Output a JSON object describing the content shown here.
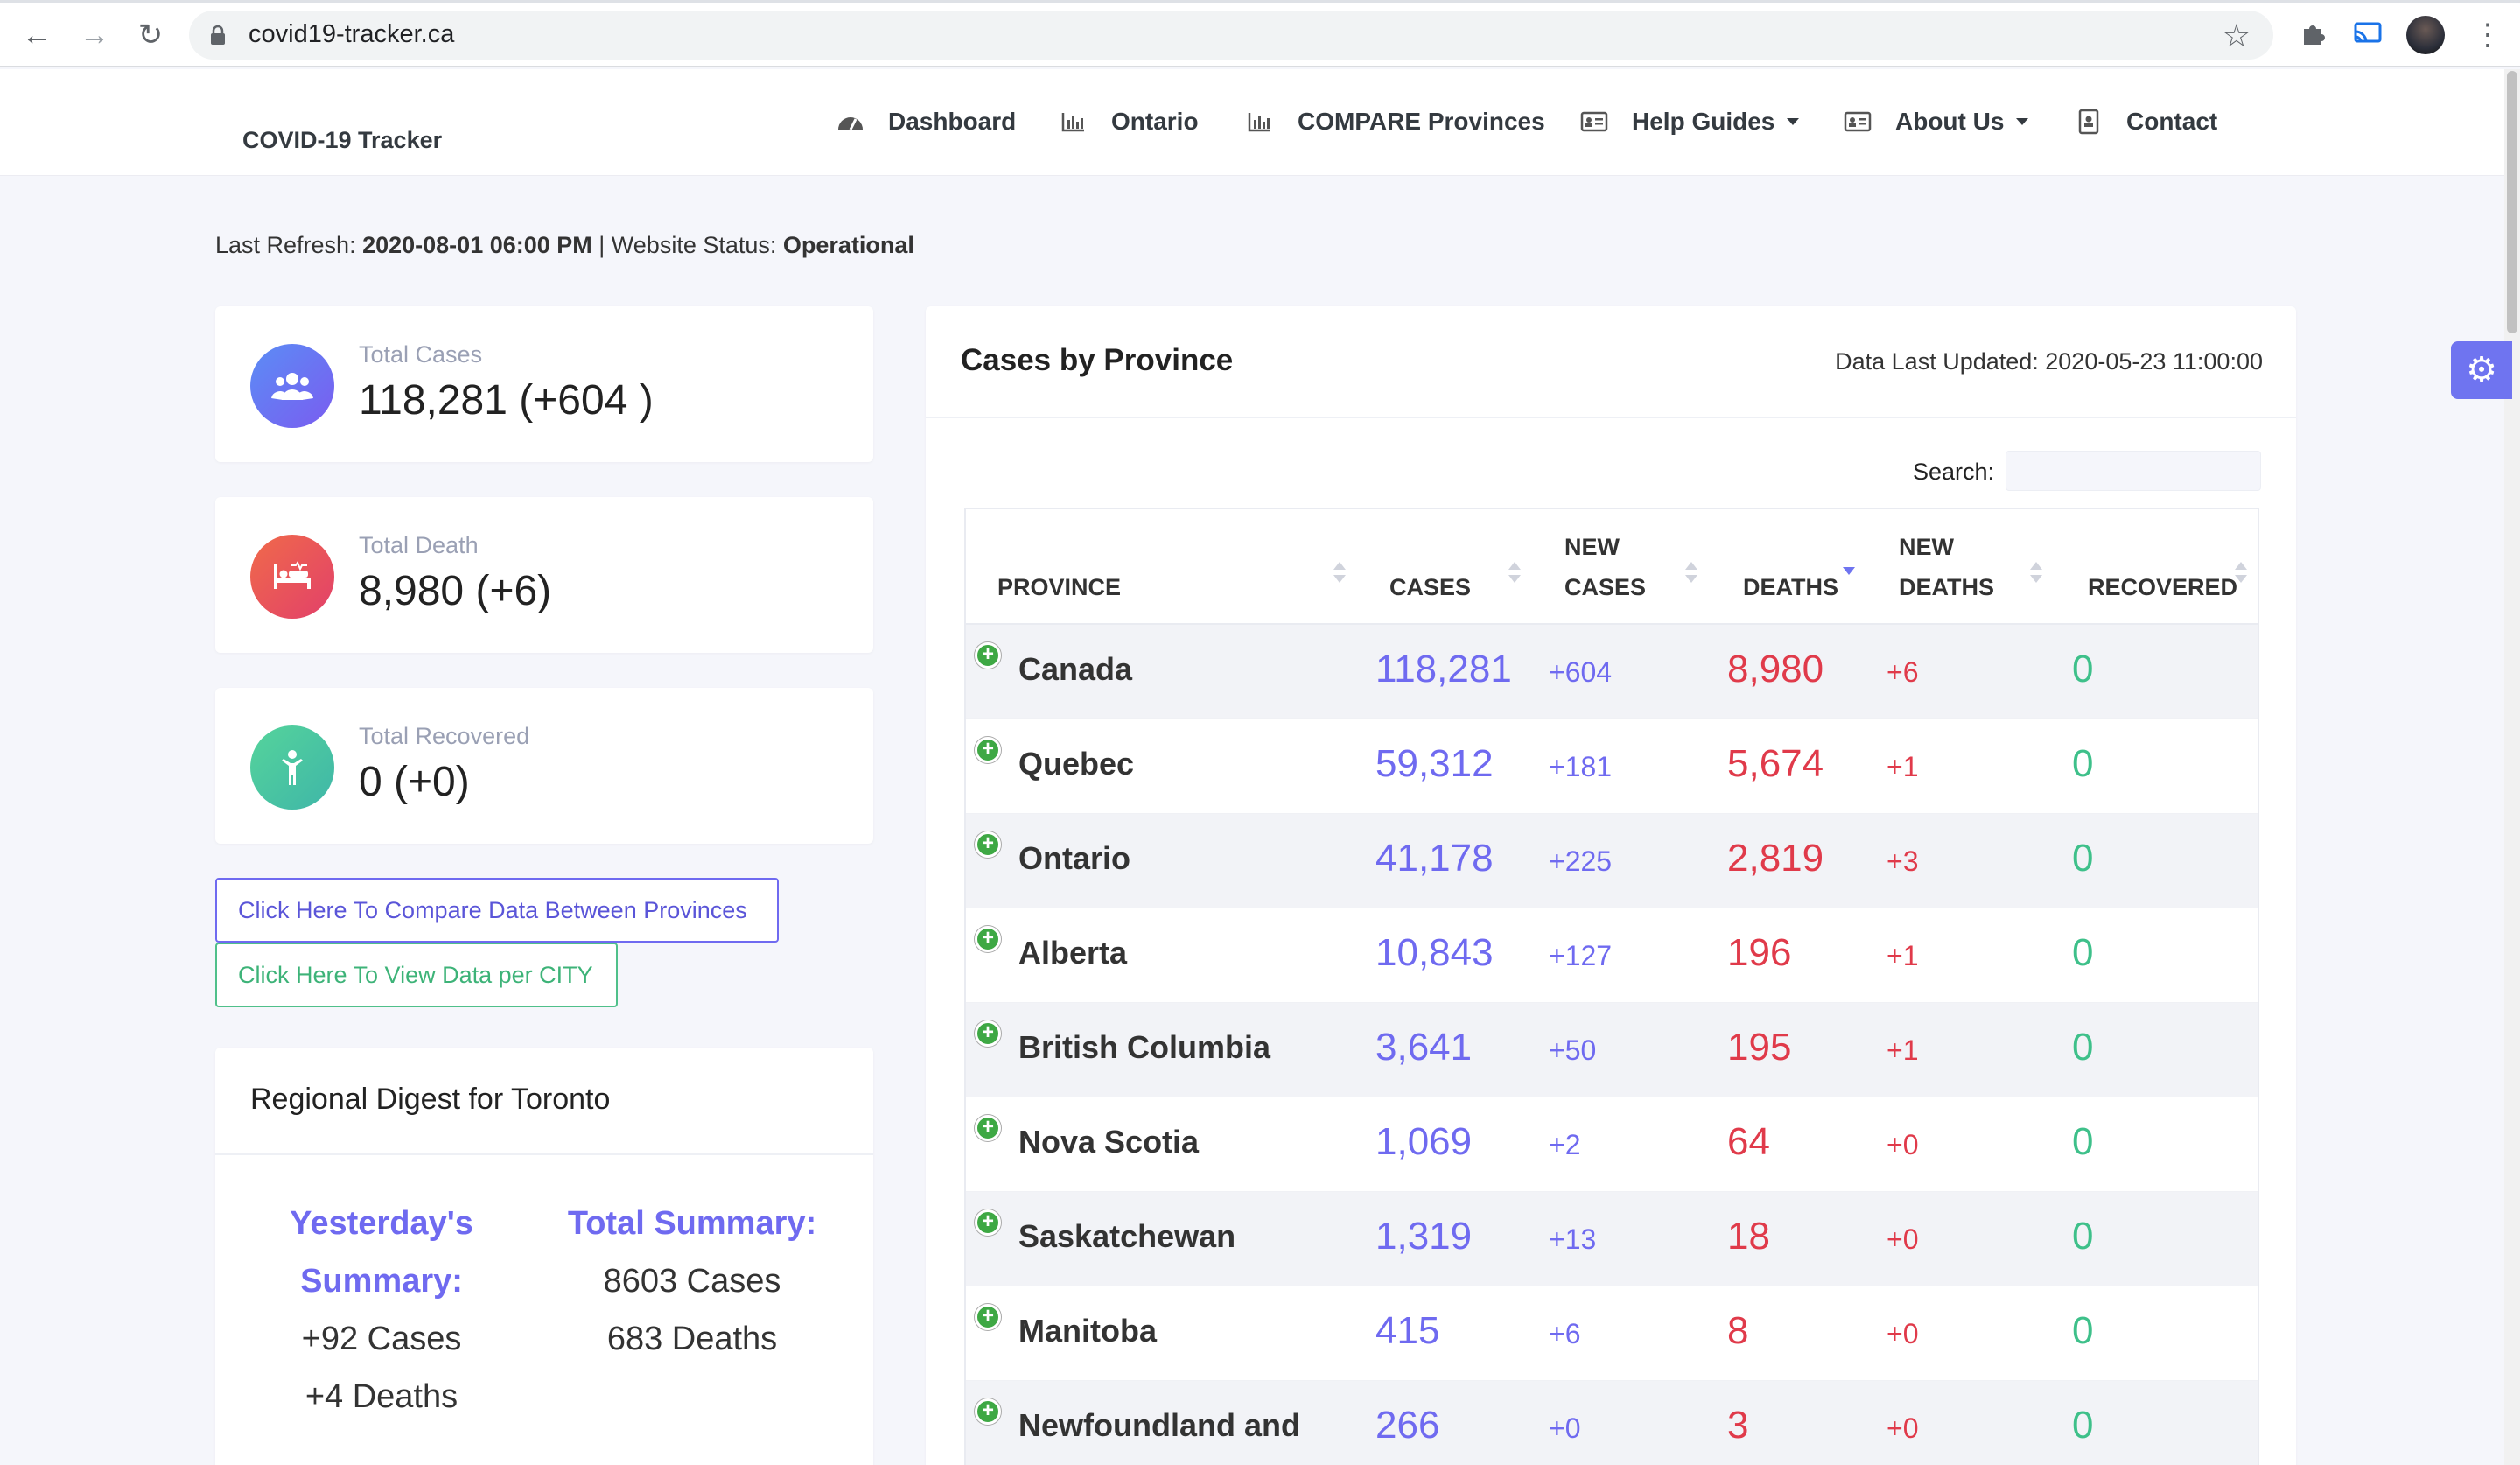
{
  "browser": {
    "url": "covid19-tracker.ca"
  },
  "navbar": {
    "brand": "COVID-19 Tracker",
    "items": [
      {
        "label": "Dashboard"
      },
      {
        "label": "Ontario"
      },
      {
        "label": "COMPARE Provinces"
      },
      {
        "label": "Help Guides"
      },
      {
        "label": "About Us"
      },
      {
        "label": "Contact"
      }
    ]
  },
  "status": {
    "refresh_label": "Last Refresh:",
    "refresh_value": "2020-08-01 06:00 PM",
    "separator": "| Website Status:",
    "status_value": "Operational"
  },
  "stats": {
    "cases": {
      "label": "Total Cases",
      "value": "118,281 (+604 )",
      "color": "#6f74f0"
    },
    "death": {
      "label": "Total Death",
      "value": "8,980 (+6)",
      "color": "#e8505b"
    },
    "recovered": {
      "label": "Total Recovered",
      "value": "0 (+0)",
      "color": "#4fcb9a"
    }
  },
  "buttons": {
    "compare": "Click Here To Compare Data Between Provinces",
    "city": "Click Here To View Data per CITY"
  },
  "digest": {
    "title": "Regional Digest for Toronto",
    "yesterday_header_1": "Yesterday's",
    "yesterday_header_2": "Summary:",
    "yesterday_cases": "+92 Cases",
    "yesterday_deaths": "+4 Deaths",
    "total_header": "Total Summary:",
    "total_cases": "8603 Cases",
    "total_deaths": "683 Deaths"
  },
  "province_table": {
    "title": "Cases by Province",
    "updated": "Data Last Updated: 2020-05-23 11:00:00",
    "search_label": "Search:",
    "search_value": "",
    "sorted_column": "deaths",
    "headers": {
      "province": "PROVINCE",
      "cases": "CASES",
      "new_cases_1": "NEW",
      "new_cases_2": "CASES",
      "deaths": "DEATHS",
      "new_deaths_1": "NEW",
      "new_deaths_2": "DEATHS",
      "recovered": "RECOVERED"
    },
    "rows": [
      {
        "province": "Canada",
        "cases": "118,281",
        "new_cases": "+604",
        "deaths": "8,980",
        "new_deaths": "+6",
        "recovered": "0"
      },
      {
        "province": "Quebec",
        "cases": "59,312",
        "new_cases": "+181",
        "deaths": "5,674",
        "new_deaths": "+1",
        "recovered": "0"
      },
      {
        "province": "Ontario",
        "cases": "41,178",
        "new_cases": "+225",
        "deaths": "2,819",
        "new_deaths": "+3",
        "recovered": "0"
      },
      {
        "province": "Alberta",
        "cases": "10,843",
        "new_cases": "+127",
        "deaths": "196",
        "new_deaths": "+1",
        "recovered": "0"
      },
      {
        "province": "British Columbia",
        "cases": "3,641",
        "new_cases": "+50",
        "deaths": "195",
        "new_deaths": "+1",
        "recovered": "0"
      },
      {
        "province": "Nova Scotia",
        "cases": "1,069",
        "new_cases": "+2",
        "deaths": "64",
        "new_deaths": "+0",
        "recovered": "0"
      },
      {
        "province": "Saskatchewan",
        "cases": "1,319",
        "new_cases": "+13",
        "deaths": "18",
        "new_deaths": "+0",
        "recovered": "0"
      },
      {
        "province": "Manitoba",
        "cases": "415",
        "new_cases": "+6",
        "deaths": "8",
        "new_deaths": "+0",
        "recovered": "0"
      },
      {
        "province": "Newfoundland and",
        "cases": "266",
        "new_cases": "+0",
        "deaths": "3",
        "new_deaths": "+0",
        "recovered": "0"
      }
    ]
  }
}
